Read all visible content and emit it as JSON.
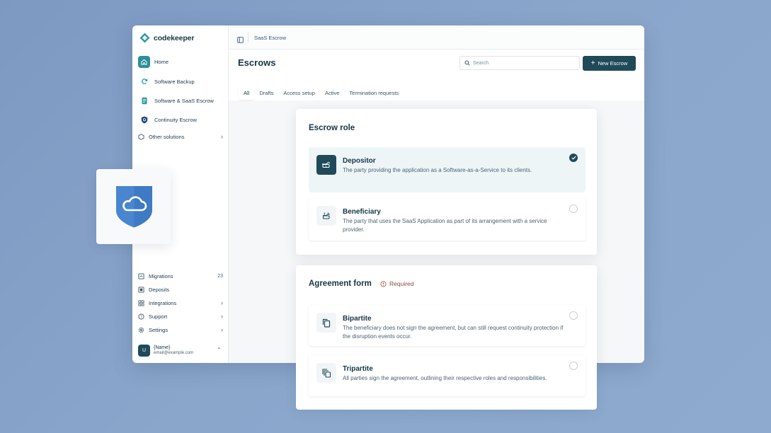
{
  "brand": {
    "name": "codekeeper"
  },
  "sidebar": {
    "items": [
      {
        "label": "Home",
        "icon": "home-icon"
      },
      {
        "label": "Software Backup",
        "icon": "refresh-icon"
      },
      {
        "label": "Software & SaaS Escrow",
        "icon": "document-icon"
      },
      {
        "label": "Continuity Escrow",
        "icon": "shield-icon"
      },
      {
        "label": "Other solutions",
        "icon": "cube-icon"
      }
    ],
    "bottom": [
      {
        "label": "Migrations",
        "icon": "migration-icon",
        "count": "23"
      },
      {
        "label": "Deposits",
        "icon": "deposit-icon"
      },
      {
        "label": "Integrations",
        "icon": "grid-icon"
      },
      {
        "label": "Support",
        "icon": "help-icon"
      },
      {
        "label": "Settings",
        "icon": "gear-icon"
      }
    ],
    "user": {
      "initial": "U",
      "name": "{Name}",
      "email": "email@example.com"
    }
  },
  "topbar": {
    "breadcrumb": "SaaS Escrow"
  },
  "header": {
    "title": "Escrows",
    "search_placeholder": "Search",
    "new_button": "New Escrow"
  },
  "tabs": [
    "All",
    "Drafts",
    "Access setup",
    "Active",
    "Termination requests"
  ],
  "escrow_role": {
    "title": "Escrow role",
    "options": [
      {
        "title": "Depositor",
        "desc": "The party providing the application as a Software-as-a-Service to its clients.",
        "selected": true
      },
      {
        "title": "Beneficiary",
        "desc": "The party that uses the SaaS Application as part of its arrangement with a service provider.",
        "selected": false
      }
    ]
  },
  "agreement_form": {
    "title": "Agreement form",
    "required_label": "Required",
    "options": [
      {
        "title": "Bipartite",
        "desc": "The beneficiary does not sign the agreement, but can still request continuity protection if the disruption events occur.",
        "selected": false
      },
      {
        "title": "Tripartite",
        "desc": "All parties sign the agreement, outlining their respective roles and responsibilities.",
        "selected": false
      }
    ]
  },
  "colors": {
    "accent": "#1f4a5a",
    "teal": "#2c8f98",
    "shield": "#3f7ac4",
    "background": "#8aa6cb"
  }
}
